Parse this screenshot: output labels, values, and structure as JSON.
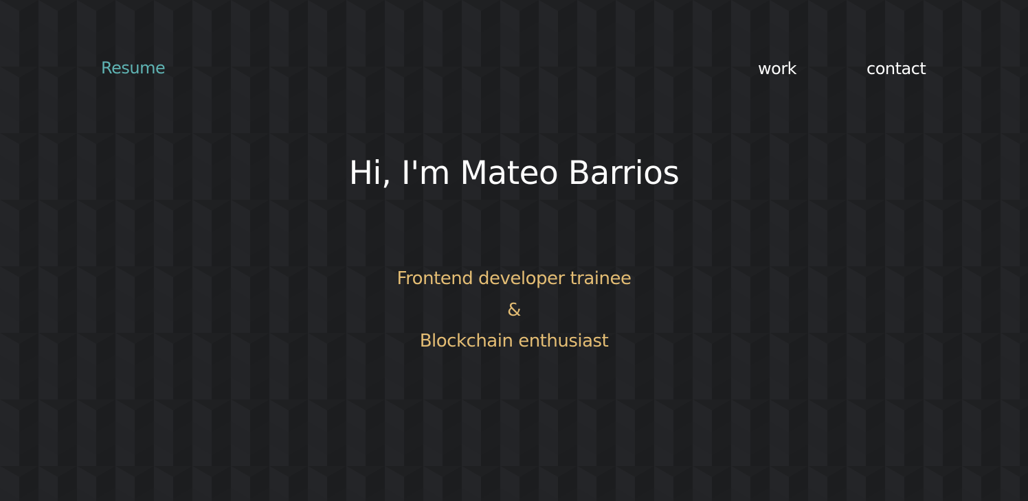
{
  "colors": {
    "background": "#1f2022",
    "resume_accent": "#5fb4b4",
    "tagline_gold": "#e4bd74",
    "nav_text": "#ffffff",
    "title_text": "#ffffff"
  },
  "nav": {
    "resume_label": "Resume",
    "links": [
      {
        "label": "work"
      },
      {
        "label": "contact"
      }
    ]
  },
  "hero": {
    "title": "Hi, I'm Mateo Barrios",
    "tagline": [
      "Frontend developer trainee",
      "&",
      "Blockchain enthusiast"
    ]
  }
}
